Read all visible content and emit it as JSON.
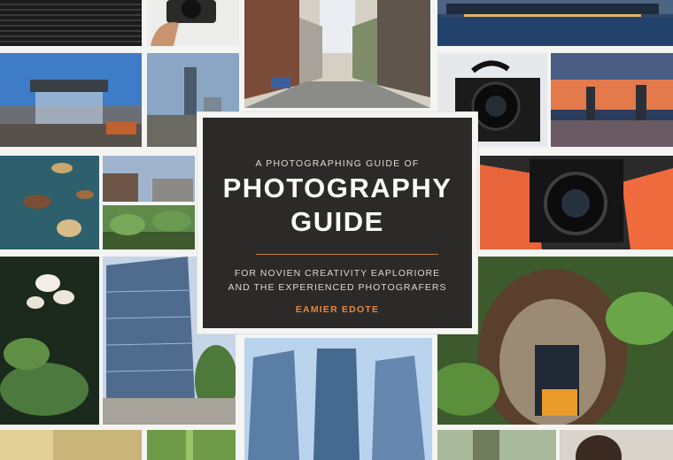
{
  "cover": {
    "kicker": "A PHOTOGRAPHING GUIDE OF",
    "title_line1": "PHOTOGRAPHY",
    "title_line2": "GUIDE",
    "subtitle_line1": "FOR NOVIEN CREATIVITY EAPLORIORE",
    "subtitle_line2": "AND THE EXPERIENCED PHOTOGRAFERS",
    "author": "EAMIER EDOTE"
  },
  "colors": {
    "cover_background": "#2b2a28",
    "title": "#fbfbf8",
    "accent_rule": "#c9773a",
    "author": "#e3893f"
  }
}
